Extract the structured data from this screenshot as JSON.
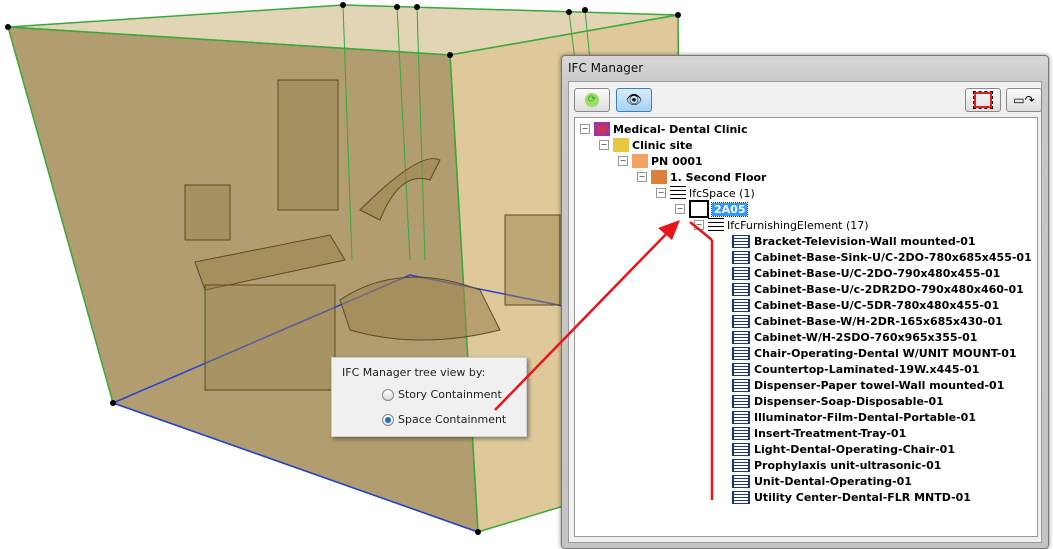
{
  "popup": {
    "title": "IFC Manager tree view by:",
    "options": [
      {
        "label": "Story Containment",
        "selected": false
      },
      {
        "label": "Space Containment",
        "selected": true
      }
    ]
  },
  "panel": {
    "title": "IFC Manager",
    "toolbar": {
      "refresh": "refresh-icon",
      "filter": "filter-eye-icon",
      "select": "select-elements-icon",
      "zoom": "zoom-to-selection-icon"
    },
    "tree": [
      {
        "label": "Medical- Dental Clinic",
        "level": 0,
        "bold": true,
        "icon": "project-icon"
      },
      {
        "label": "Clinic site",
        "level": 1,
        "bold": true,
        "icon": "site-icon"
      },
      {
        "label": "PN 0001",
        "level": 2,
        "bold": true,
        "icon": "building-icon"
      },
      {
        "label": "1. Second Floor",
        "level": 3,
        "bold": true,
        "icon": "storey-icon"
      },
      {
        "label": "IfcSpace (1)",
        "level": 4,
        "bold": false,
        "icon": "group-icon"
      },
      {
        "label": "2A05",
        "level": 5,
        "bold": true,
        "icon": "space-icon",
        "selected": true
      },
      {
        "label": "IfcFurnishingElement (17)",
        "level": 6,
        "bold": false,
        "icon": "group-icon"
      }
    ],
    "items": [
      "Bracket-Television-Wall mounted-01",
      "Cabinet-Base-Sink-U/C-2DO-780x685x455-01",
      "Cabinet-Base-U/C-2DO-790x480x455-01",
      "Cabinet-Base-U/c-2DR2DO-790x480x460-01",
      "Cabinet-Base-U/C-5DR-780x480x455-01",
      "Cabinet-Base-W/H-2DR-165x685x430-01",
      "Cabinet-W/H-2SDO-760x965x355-01",
      "Chair-Operating-Dental W/UNIT MOUNT-01",
      "Countertop-Laminated-19W.x445-01",
      "Dispenser-Paper towel-Wall mounted-01",
      "Dispenser-Soap-Disposable-01",
      "Illuminator-Film-Dental-Portable-01",
      "Insert-Treatment-Tray-01",
      "Light-Dental-Operating-Chair-01",
      "Prophylaxis unit-ultrasonic-01",
      "Unit-Dental-Operating-01",
      "Utility Center-Dental-FLR MNTD-01"
    ]
  },
  "colors": {
    "space_fill": "#b39b5e",
    "edge_green": "#3aa83a",
    "edge_blue": "#2a3fd0",
    "arrow": "#e8161b",
    "selection": "#3399ff"
  }
}
